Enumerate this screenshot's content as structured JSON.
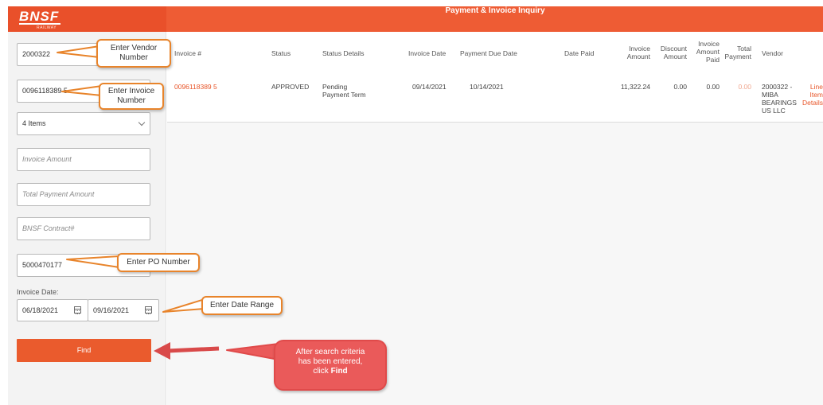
{
  "logo": {
    "text": "BNSF",
    "sub": "RAILWAY"
  },
  "header": {
    "title": "Payment & Invoice Inquiry"
  },
  "search": {
    "vendor_number": "2000322",
    "invoice_number": "0096118389 5",
    "items_select": "4 Items",
    "invoice_amount_placeholder": "Invoice Amount",
    "total_payment_placeholder": "Total Payment Amount",
    "contract_placeholder": "BNSF Contract#",
    "po_number": "5000470177",
    "date_label": "Invoice Date:",
    "date_from": "06/18/2021",
    "date_to": "09/16/2021",
    "find_label": "Find"
  },
  "table": {
    "headers": {
      "invoice": "Invoice #",
      "status": "Status",
      "status_details": "Status Details",
      "invoice_date": "Invoice Date",
      "payment_due_date": "Payment Due Date",
      "date_paid": "Date Paid",
      "invoice_amount_1": "Invoice",
      "invoice_amount_2": "Amount",
      "discount_amount_1": "Discount",
      "discount_amount_2": "Amount",
      "invoice_amount_paid_1": "Invoice",
      "invoice_amount_paid_2": "Amount",
      "invoice_amount_paid_3": "Paid",
      "total_payment_1": "Total",
      "total_payment_2": "Payment",
      "vendor": "Vendor"
    },
    "row": {
      "invoice": "0096118389 5",
      "status": "APPROVED",
      "status_details_1": "Pending",
      "status_details_2": "Payment Term",
      "invoice_date": "09/14/2021",
      "payment_due_date": "10/14/2021",
      "date_paid": "",
      "invoice_amount": "11,322.24",
      "discount_amount": "0.00",
      "invoice_amount_paid": "0.00",
      "total_payment": "0.00",
      "vendor_1": "2000322 -",
      "vendor_2": "MIBA",
      "vendor_3": "BEARINGS",
      "vendor_4": "US LLC",
      "line_items_1": "Line",
      "line_items_2": "Item",
      "line_items_3": "Details"
    }
  },
  "callouts": {
    "vendor_1": "Enter Vendor",
    "vendor_2": "Number",
    "invoice_1": "Enter Invoice",
    "invoice_2": "Number",
    "po": "Enter PO Number",
    "date_range": "Enter Date Range",
    "find_1": "After search criteria",
    "find_2": "has been entered,",
    "find_3_pre": "click ",
    "find_3_bold": "Find"
  },
  "colors": {
    "brand": "#ee5c34",
    "callout_border": "#e8842b",
    "callout_red": "#ea5a5a"
  }
}
